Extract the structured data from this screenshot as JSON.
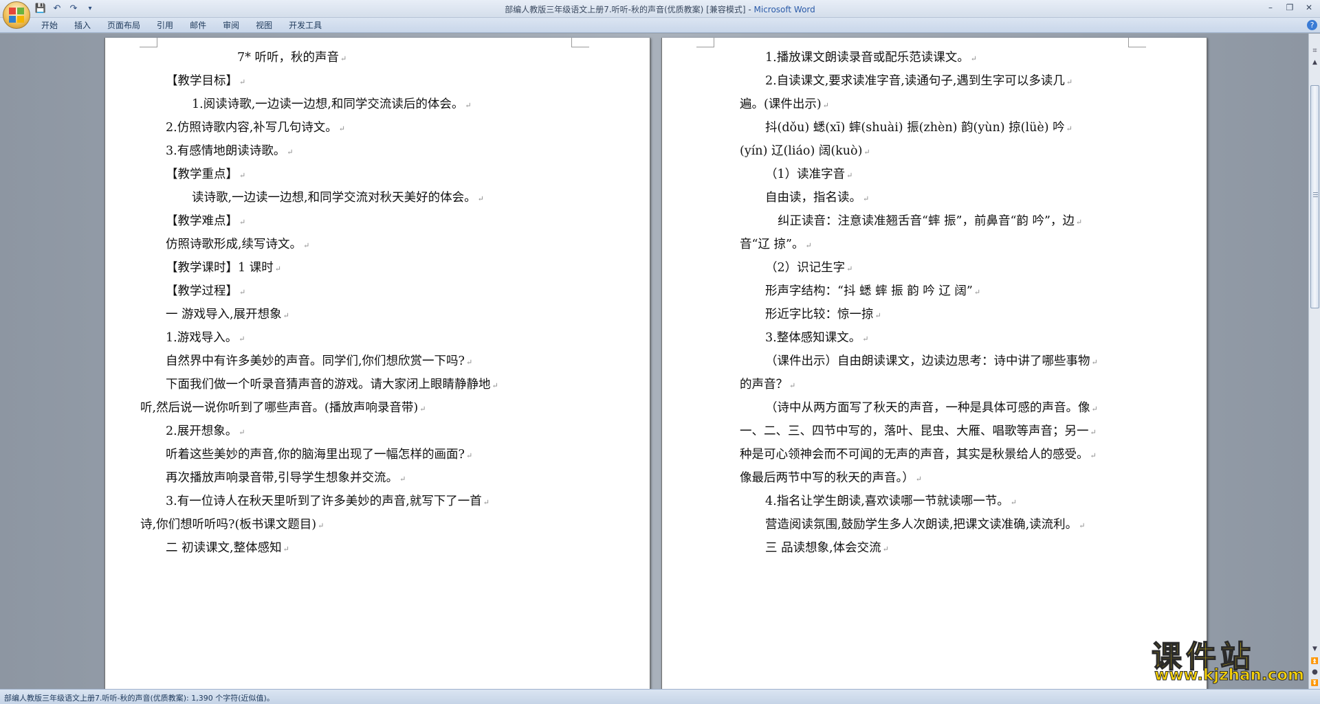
{
  "window": {
    "title_doc": "部编人教版三年级语文上册7.听听-秋的声音(优质教案) [兼容模式] -",
    "title_app": "Microsoft Word"
  },
  "qat": {
    "save": "💾",
    "undo": "↶",
    "redo": "↷",
    "customize": "▾"
  },
  "controls": {
    "minimize": "–",
    "restore": "❐",
    "close": "✕"
  },
  "ribbon": {
    "tabs": [
      "开始",
      "插入",
      "页面布局",
      "引用",
      "邮件",
      "审阅",
      "视图",
      "开发工具"
    ],
    "help": "?"
  },
  "paragraph_mark": "↵",
  "page_left": {
    "lines": [
      "7* 听听，秋的声音",
      "【教学目标】",
      "1.阅读诗歌,一边读一边想,和同学交流读后的体会。",
      "2.仿照诗歌内容,补写几句诗文。",
      "3.有感情地朗读诗歌。",
      "【教学重点】",
      "读诗歌,一边读一边想,和同学交流对秋天美好的体会。",
      "【教学难点】",
      "仿照诗歌形成,续写诗文。",
      "【教学课时】1 课时",
      "【教学过程】",
      "一   游戏导入,展开想象",
      "1.游戏导入。",
      "自然界中有许多美妙的声音。同学们,你们想欣赏一下吗?",
      "下面我们做一个听录音猜声音的游戏。请大家闭上眼睛静静地",
      "听,然后说一说你听到了哪些声音。(播放声响录音带)",
      "2.展开想象。",
      "听着这些美妙的声音,你的脑海里出现了一幅怎样的画面?",
      "再次播放声响录音带,引导学生想象并交流。",
      "3.有一位诗人在秋天里听到了许多美妙的声音,就写下了一首",
      "诗,你们想听听吗?(板书课文题目)",
      "二   初读课文,整体感知"
    ]
  },
  "page_right": {
    "lines": [
      "1.播放课文朗读录音或配乐范读课文。",
      "2.自读课文,要求读准字音,读通句子,遇到生字可以多读几",
      "遍。(课件出示)",
      "抖(dǒu) 蟋(xī) 蟀(shuài) 振(zhèn) 韵(yùn) 掠(lüè) 吟",
      "(yín) 辽(liáo) 阔(kuò)",
      "（1）读准字音",
      "自由读，指名读。",
      "纠正读音：注意读准翘舌音“蟀 振”，前鼻音“韵 吟”，边",
      "音“辽 掠”。",
      "（2）识记生字",
      "形声字结构：“抖 蟋 蟀 振 韵 吟 辽 阔”",
      "形近字比较：惊一掠",
      "3.整体感知课文。",
      "（课件出示）自由朗读课文，边读边思考：诗中讲了哪些事物",
      "的声音？",
      "（诗中从两方面写了秋天的声音，一种是具体可感的声音。像",
      "一、二、三、四节中写的，落叶、昆虫、大雁、唱歌等声音；另一",
      "种是可心领神会而不可闻的无声的声音，其实是秋景给人的感受。",
      "像最后两节中写的秋天的声音。）",
      "4.指名让学生朗读,喜欢读哪一节就读哪一节。",
      "营造阅读氛围,鼓励学生多人次朗读,把课文读准确,读流利。",
      "三   品读想象,体会交流"
    ]
  },
  "scrollbar": {
    "up": "▲",
    "down": "▼",
    "ruler": "⌗",
    "prev_page": "⏫",
    "browse": "●",
    "next_page": "⏬"
  },
  "status": {
    "text": "部编人教版三年级语文上册7.听听-秋的声音(优质教案): 1,390 个字符(近似值)。"
  },
  "watermark": {
    "title": "课件站",
    "url": "www.kjzhan.com"
  },
  "colors": {
    "accent": "#2a5aa8",
    "watermark": "#f6d20a"
  }
}
